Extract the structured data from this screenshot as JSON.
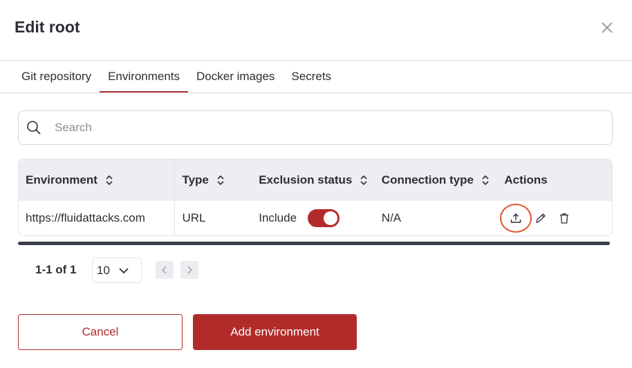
{
  "dialog": {
    "title": "Edit root"
  },
  "tabs": [
    {
      "label": "Git repository",
      "active": false
    },
    {
      "label": "Environments",
      "active": true
    },
    {
      "label": "Docker images",
      "active": false
    },
    {
      "label": "Secrets",
      "active": false
    }
  ],
  "search": {
    "placeholder": "Search",
    "value": ""
  },
  "table": {
    "columns": [
      "Environment",
      "Type",
      "Exclusion status",
      "Connection type",
      "Actions"
    ],
    "rows": [
      {
        "environment": "https://fluidattacks.com",
        "type": "URL",
        "exclusion_status": "Include",
        "exclusion_toggle_on": true,
        "connection_type": "N/A",
        "actions": [
          "upload-icon",
          "pencil-icon",
          "trash-icon"
        ]
      }
    ]
  },
  "pagination": {
    "info": "1-1 of 1",
    "page_size": "10"
  },
  "buttons": {
    "cancel": "Cancel",
    "add": "Add environment"
  },
  "colors": {
    "accent": "#b22b2b",
    "focus_ring": "#e2542d",
    "header_bg": "#eeeef2"
  }
}
